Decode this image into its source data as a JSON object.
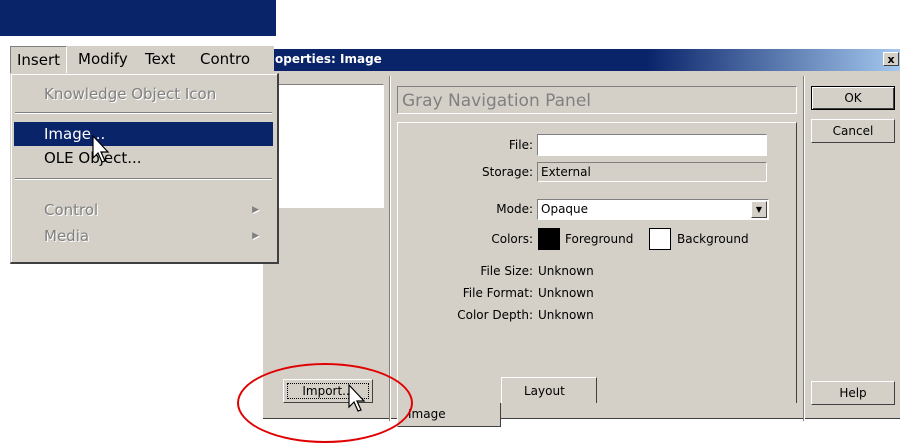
{
  "app": {
    "menubar": [
      "Insert",
      "Modify",
      "Text",
      "Contro"
    ]
  },
  "insert_menu": {
    "items": [
      {
        "label": "Knowledge Object Icon",
        "state": "disabled"
      },
      {
        "label": "Image...",
        "state": "selected"
      },
      {
        "label": "OLE Object...",
        "state": "enabled"
      },
      {
        "label": "Control",
        "state": "disabled",
        "submenu": true
      },
      {
        "label": "Media",
        "state": "disabled",
        "submenu": true
      }
    ]
  },
  "dialog": {
    "title": "operties: Image",
    "close_glyph": "x",
    "icon_name": "Gray Navigation Panel",
    "file": {
      "label": "File:",
      "value": ""
    },
    "storage": {
      "label": "Storage:",
      "value": "External"
    },
    "mode": {
      "label": "Mode:",
      "value": "Opaque"
    },
    "colors": {
      "label": "Colors:",
      "foreground": "Foreground",
      "background": "Background",
      "foreground_color": "#000000",
      "background_color": "#ffffff"
    },
    "file_size": {
      "label": "File Size:",
      "value": "Unknown"
    },
    "file_format": {
      "label": "File Format:",
      "value": "Unknown"
    },
    "color_depth": {
      "label": "Color Depth:",
      "value": "Unknown"
    },
    "tabs": [
      "Image",
      "Layout"
    ],
    "buttons": {
      "ok": "OK",
      "cancel": "Cancel",
      "help": "Help",
      "import": "Import..."
    }
  },
  "annotation": {
    "color": "#e00000"
  }
}
